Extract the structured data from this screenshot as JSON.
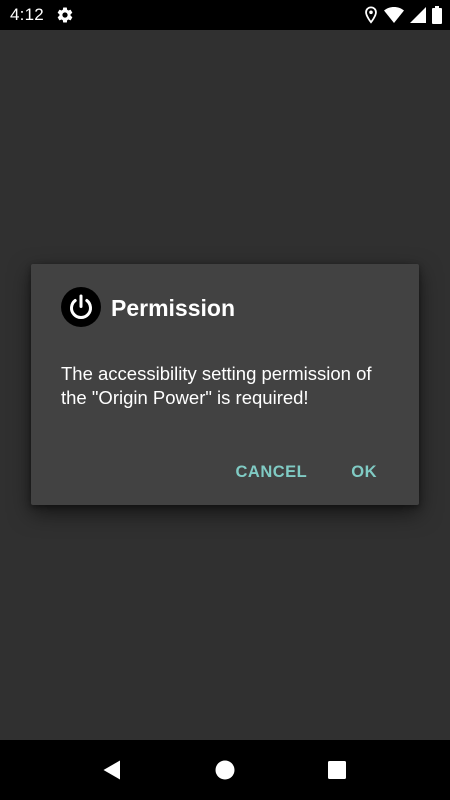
{
  "status_bar": {
    "time": "4:12",
    "icons": [
      "settings-gear-icon",
      "location-icon",
      "wifi-icon",
      "signal-icon",
      "battery-icon"
    ]
  },
  "dialog": {
    "icon": "power-icon",
    "title": "Permission",
    "message": "The accessibility setting permission of the \"Origin Power\" is required!",
    "cancel_label": "CANCEL",
    "ok_label": "OK"
  },
  "nav_bar": {
    "icons": [
      "back-icon",
      "home-icon",
      "recents-icon"
    ]
  },
  "colors": {
    "background": "#303030",
    "dialog_background": "#424242",
    "accent": "#80cbc4",
    "bars": "#000000",
    "text": "#ffffff"
  }
}
